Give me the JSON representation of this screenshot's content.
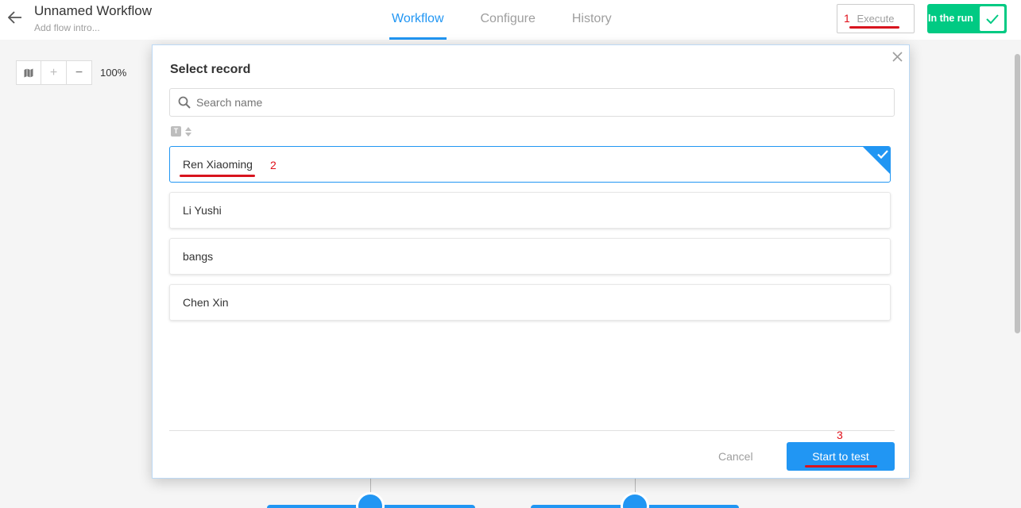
{
  "header": {
    "title": "Unnamed Workflow",
    "subtitle": "Add flow intro...",
    "tabs": [
      {
        "label": "Workflow",
        "active": true
      },
      {
        "label": "Configure",
        "active": false
      },
      {
        "label": "History",
        "active": false
      }
    ],
    "execute_label": "Execute",
    "run_label": "In the run"
  },
  "canvas": {
    "zoom_level": "100%"
  },
  "dialog": {
    "title": "Select record",
    "search_placeholder": "Search name",
    "sort_icon_letter": "T",
    "records": [
      {
        "name": "Ren Xiaoming",
        "selected": true
      },
      {
        "name": "Li Yushi",
        "selected": false
      },
      {
        "name": "bangs",
        "selected": false
      },
      {
        "name": "Chen Xin",
        "selected": false
      }
    ],
    "cancel_label": "Cancel",
    "start_label": "Start to test"
  },
  "annotations": {
    "step1": "1",
    "step2": "2",
    "step3": "3"
  },
  "colors": {
    "accent": "#2196f3",
    "run_green": "#01ca83",
    "annotation_red": "#e0101a"
  }
}
